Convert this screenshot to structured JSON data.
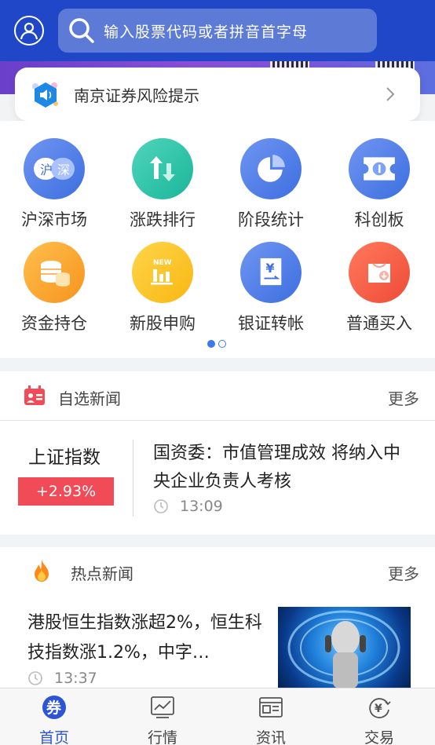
{
  "header": {
    "search_placeholder": "输入股票代码或者拼音首字母"
  },
  "notice": {
    "text": "南京证券风险提示"
  },
  "grid": [
    {
      "label": "沪深市场",
      "icon": "hushen-icon",
      "ic_text_a": "沪",
      "ic_text_b": "深",
      "color_a": "#3d6fe0",
      "color_b": "#6f95f1"
    },
    {
      "label": "涨跌排行",
      "icon": "updown-arrows-icon",
      "color_a": "#1bb59a",
      "color_b": "#4fd6bc"
    },
    {
      "label": "阶段统计",
      "icon": "pie-chart-icon",
      "color_a": "#3d6fe0",
      "color_b": "#6f95f1"
    },
    {
      "label": "科创板",
      "icon": "ticket-icon",
      "color_a": "#3d6fe0",
      "color_b": "#6f95f1"
    },
    {
      "label": "资金持仓",
      "icon": "coins-icon",
      "color_a": "#f7941d",
      "color_b": "#ffbf4d"
    },
    {
      "label": "新股申购",
      "icon": "new-bars-icon",
      "ic_text_a": "NEW",
      "color_a": "#f9b712",
      "color_b": "#ffd54a"
    },
    {
      "label": "银证转帐",
      "icon": "yuan-card-icon",
      "ic_text_a": "¥",
      "color_a": "#3d6fe0",
      "color_b": "#6f95f1"
    },
    {
      "label": "普通买入",
      "icon": "bag-icon",
      "color_a": "#ee4b37",
      "color_b": "#ff7a5c"
    }
  ],
  "pager": {
    "active": 0,
    "count": 2,
    "active_color": "#3d7ae8"
  },
  "watch_news": {
    "title": "自选新闻",
    "more": "更多",
    "index_name": "上证指数",
    "index_change": "+2.93%",
    "headline": "国资委：市值管理成效 将纳入中央企业负责人考核",
    "time": "13:09"
  },
  "hot_news": {
    "title": "热点新闻",
    "more": "更多",
    "headline": "港股恒生指数涨超2%，恒生科技指数涨1.2%，中字…",
    "time": "13:37"
  },
  "nav": [
    {
      "label": "首页",
      "active": true,
      "icon": "home-icon",
      "glyph": "券"
    },
    {
      "label": "行情",
      "active": false,
      "icon": "market-icon"
    },
    {
      "label": "资讯",
      "active": false,
      "icon": "news-icon"
    },
    {
      "label": "交易",
      "active": false,
      "icon": "trade-icon",
      "glyph": "¥"
    }
  ],
  "colors": {
    "brand": "#1f47c7",
    "accent": "#2e54d6",
    "up": "#f04b57"
  }
}
